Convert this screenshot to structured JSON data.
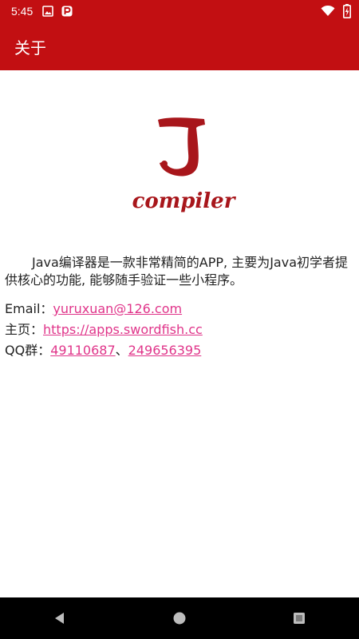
{
  "status_bar": {
    "time": "5:45",
    "icons": [
      "image-icon",
      "parking-icon",
      "wifi-icon",
      "battery-charging-icon"
    ]
  },
  "app_bar": {
    "title": "关于"
  },
  "logo": {
    "letter": "J",
    "word": "compiler",
    "color": "#a8161b"
  },
  "content": {
    "description": "Java编译器是一款非常精简的APP, 主要为Java初学者提供核心的功能, 能够随手验证一些小程序。",
    "email_label": "Email：",
    "email_value": "yuruxuan@126.com",
    "homepage_label": "主页：",
    "homepage_value": "https://apps.swordfish.cc",
    "qq_label": "QQ群：",
    "qq_group_1": "49110687",
    "qq_separator": "、",
    "qq_group_2": "249656395"
  },
  "nav_bar": {
    "icons": [
      "back-icon",
      "home-icon",
      "recents-icon"
    ]
  },
  "colors": {
    "primary": "#c20f12",
    "link": "#e0358a",
    "text": "#222222"
  }
}
